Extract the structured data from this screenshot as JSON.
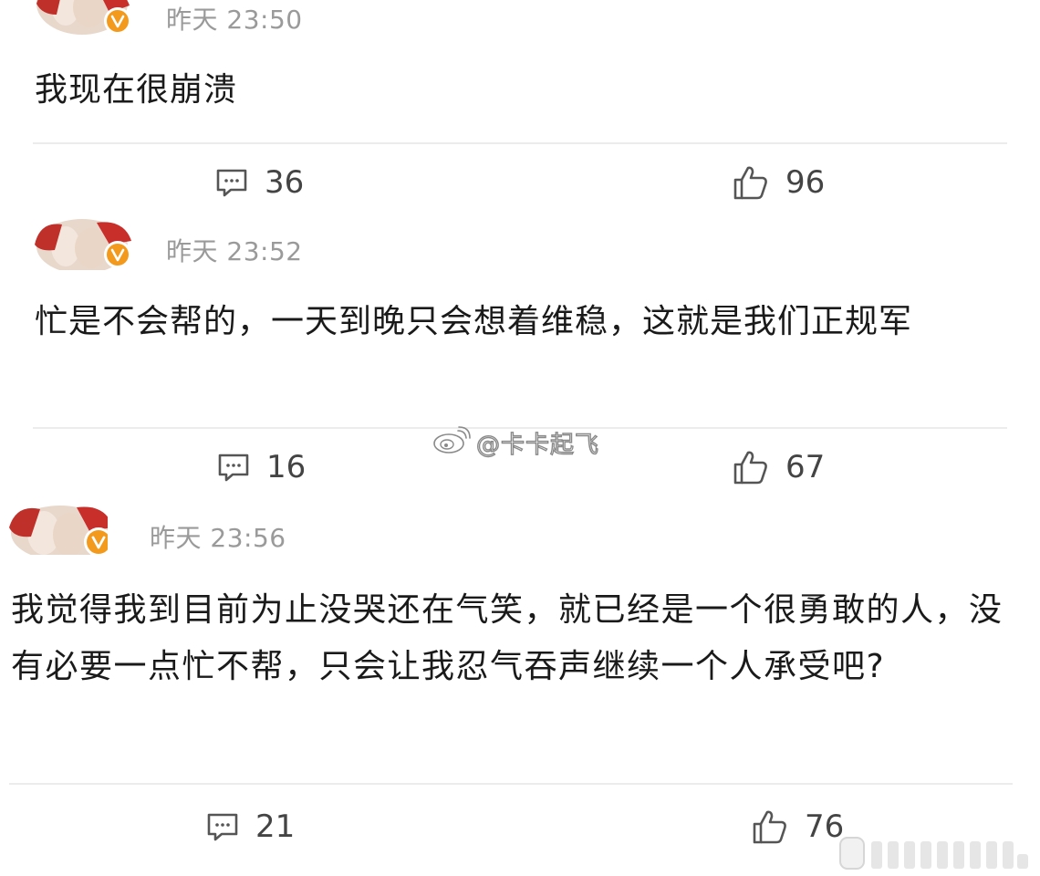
{
  "posts": [
    {
      "timestamp": "昨天 23:50",
      "text": "我现在很崩溃",
      "comment_count": "36",
      "like_count": "96"
    },
    {
      "timestamp": "昨天 23:52",
      "text": "忙是不会帮的，一天到晚只会想着维稳，这就是我们正规军",
      "comment_count": "16",
      "like_count": "67"
    },
    {
      "timestamp": "昨天 23:56",
      "text": "我觉得我到目前为止没哭还在气笑，就已经是一个很勇敢的人，没有必要一点忙不帮，只会让我忍气吞声继续一个人承受吧?",
      "comment_count": "21",
      "like_count": "76"
    }
  ],
  "watermark": {
    "text": "@卡卡起飞"
  },
  "icons": {
    "comment": "comment-icon",
    "like": "thumbs-up-icon",
    "verified": "verified-badge-icon",
    "weibo": "weibo-logo-icon"
  },
  "colors": {
    "timestamp": "#9a9a9a",
    "verified_badge": "#f39a1c",
    "divider": "#ececec"
  }
}
